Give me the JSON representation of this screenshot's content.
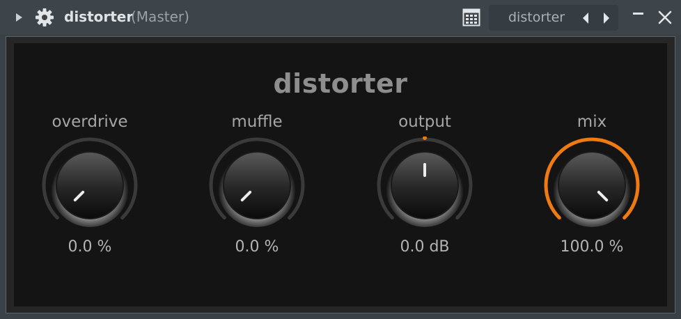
{
  "window": {
    "title": "distorter",
    "context": "(Master)",
    "preset_name": "distorter",
    "icons": {
      "expand": "triangle-right-icon",
      "settings": "gear-icon",
      "grid": "grid-icon",
      "prev": "arrow-left-icon",
      "next": "arrow-right-icon",
      "minimize": "minimize-icon",
      "close": "close-icon"
    }
  },
  "plugin": {
    "heading": "distorter",
    "accent_color": "#f07a12",
    "knobs": [
      {
        "id": "overdrive",
        "label": "overdrive",
        "value": "0.0 %",
        "level": 0.0,
        "colored_ring": false
      },
      {
        "id": "muffle",
        "label": "muffle",
        "value": "0.0 %",
        "level": 0.0,
        "colored_ring": false
      },
      {
        "id": "output",
        "label": "output",
        "value": "0.0 dB",
        "level": 0.5,
        "colored_ring": false,
        "center_marker": true
      },
      {
        "id": "mix",
        "label": "mix",
        "value": "100.0 %",
        "level": 1.0,
        "colored_ring": true
      }
    ]
  }
}
